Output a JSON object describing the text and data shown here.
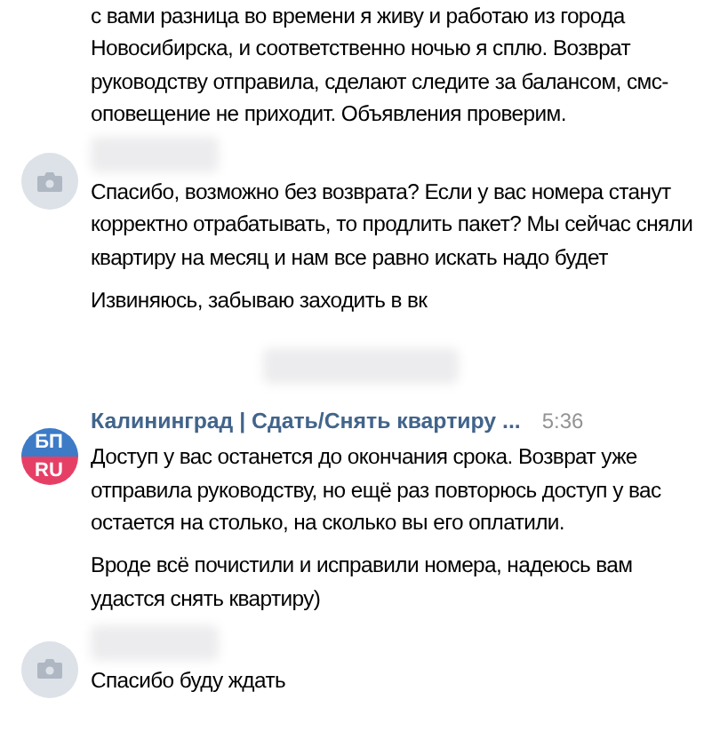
{
  "feed": [
    {
      "kind": "continuation",
      "paragraphs": [
        "с вами разница во времени я живу и работаю из города Новосибирска, и соответственно ночью я сплю. Возврат руководству отправила, сделают следите за балансом, смс-оповещение не приходит. Объявления проверим."
      ]
    },
    {
      "kind": "message",
      "avatar": {
        "kind": "camera"
      },
      "paragraphs": [
        "Спасибо, возможно без возврата? Если у вас номера станут корректно отрабатывать, то продлить пакет? Мы сейчас сняли квартиру на месяц и нам все равно искать надо будет",
        "Извиняюсь, забываю заходить в вк"
      ]
    },
    {
      "kind": "divider"
    },
    {
      "kind": "message",
      "avatar": {
        "kind": "logo",
        "top": "БП",
        "bottom": "RU"
      },
      "author": "Калининград | Сдать/Снять квартиру ...",
      "time": "5:36",
      "paragraphs": [
        "Доступ у вас останется до окончания срока. Возврат уже отправила руководству, но ещё раз повторюсь доступ у вас остается на столько, на сколько вы его оплатили.",
        "Вроде всё почистили и исправили номера, надеюсь вам удастся снять квартиру)"
      ]
    },
    {
      "kind": "message",
      "avatar": {
        "kind": "camera"
      },
      "paragraphs": [
        "Спасибо буду ждать"
      ]
    }
  ]
}
